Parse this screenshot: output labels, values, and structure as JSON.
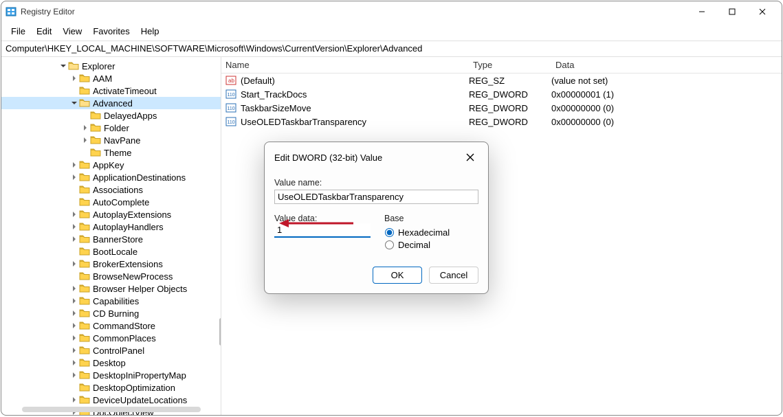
{
  "window": {
    "title": "Registry Editor"
  },
  "menu": {
    "file": "File",
    "edit": "Edit",
    "view": "View",
    "favorites": "Favorites",
    "help": "Help"
  },
  "address": "Computer\\HKEY_LOCAL_MACHINE\\SOFTWARE\\Microsoft\\Windows\\CurrentVersion\\Explorer\\Advanced",
  "tree": {
    "root": "Explorer",
    "children": [
      {
        "name": "AAM",
        "caret": ">"
      },
      {
        "name": "ActivateTimeout",
        "caret": ""
      },
      {
        "name": "Advanced",
        "caret": "v",
        "selected": true,
        "children": [
          {
            "name": "DelayedApps",
            "caret": ""
          },
          {
            "name": "Folder",
            "caret": ">"
          },
          {
            "name": "NavPane",
            "caret": ">"
          },
          {
            "name": "Theme",
            "caret": ""
          }
        ]
      },
      {
        "name": "AppKey",
        "caret": ">"
      },
      {
        "name": "ApplicationDestinations",
        "caret": ">"
      },
      {
        "name": "Associations",
        "caret": ""
      },
      {
        "name": "AutoComplete",
        "caret": ""
      },
      {
        "name": "AutoplayExtensions",
        "caret": ">"
      },
      {
        "name": "AutoplayHandlers",
        "caret": ">"
      },
      {
        "name": "BannerStore",
        "caret": ">"
      },
      {
        "name": "BootLocale",
        "caret": ""
      },
      {
        "name": "BrokerExtensions",
        "caret": ">"
      },
      {
        "name": "BrowseNewProcess",
        "caret": ""
      },
      {
        "name": "Browser Helper Objects",
        "caret": ">"
      },
      {
        "name": "Capabilities",
        "caret": ">"
      },
      {
        "name": "CD Burning",
        "caret": ">"
      },
      {
        "name": "CommandStore",
        "caret": ">"
      },
      {
        "name": "CommonPlaces",
        "caret": ">"
      },
      {
        "name": "ControlPanel",
        "caret": ">"
      },
      {
        "name": "Desktop",
        "caret": ">"
      },
      {
        "name": "DesktopIniPropertyMap",
        "caret": ">"
      },
      {
        "name": "DesktopOptimization",
        "caret": ""
      },
      {
        "name": "DeviceUpdateLocations",
        "caret": ">"
      },
      {
        "name": "DocObjectView",
        "caret": ">"
      }
    ]
  },
  "columns": {
    "name": "Name",
    "type": "Type",
    "data": "Data"
  },
  "values": [
    {
      "icon": "string",
      "name": "(Default)",
      "type": "REG_SZ",
      "data": "(value not set)"
    },
    {
      "icon": "dword",
      "name": "Start_TrackDocs",
      "type": "REG_DWORD",
      "data": "0x00000001 (1)"
    },
    {
      "icon": "dword",
      "name": "TaskbarSizeMove",
      "type": "REG_DWORD",
      "data": "0x00000000 (0)"
    },
    {
      "icon": "dword",
      "name": "UseOLEDTaskbarTransparency",
      "type": "REG_DWORD",
      "data": "0x00000000 (0)"
    }
  ],
  "dialog": {
    "title": "Edit DWORD (32-bit) Value",
    "value_name_label": "Value name:",
    "value_name": "UseOLEDTaskbarTransparency",
    "value_data_label": "Value data:",
    "value_data": "1",
    "base_label": "Base",
    "radio_hex": "Hexadecimal",
    "radio_dec": "Decimal",
    "selected_base": "hex",
    "ok": "OK",
    "cancel": "Cancel"
  }
}
